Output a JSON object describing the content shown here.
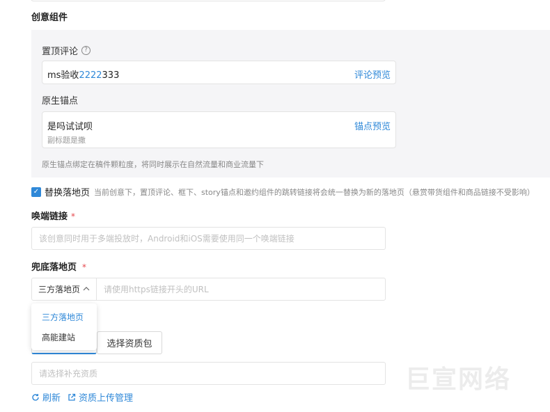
{
  "section": {
    "title": "创意组件"
  },
  "pinned_comment": {
    "label": "置顶评论",
    "help_icon": "?",
    "value_prefix": "ms验收",
    "value_highlight": "2222",
    "value_suffix": "333",
    "preview_link": "评论预览"
  },
  "native_anchor": {
    "label": "原生锚点",
    "title": "是吗试试呗",
    "subtitle": "副标题是撒",
    "preview_link": "锚点预览",
    "hint": "原生锚点绑定在稿件颗粒度，将同时展示在自然流量和商业流量下"
  },
  "replace_landing": {
    "checked": true,
    "check_mark": "✓",
    "label": "替换落地页",
    "description": "当前创意下，置顶评论、框下、story锚点和邀约组件的跳转链接将会统一替换为新的落地页（悬赏带货组件和商品链接不受影响）"
  },
  "wakeup_link": {
    "title": "唤端链接",
    "required_mark": "*",
    "placeholder": "该创意同时用于多端投放时，Android和iOS需要使用同一个唤端链接"
  },
  "fallback_landing": {
    "title": "兜底落地页",
    "required_mark": "*",
    "select_value": "三方落地页",
    "url_placeholder": "请使用https链接开头的URL",
    "options": [
      "三方落地页",
      "高能建站"
    ]
  },
  "resources": {
    "pack_button": "选择资质包",
    "placeholder": "请选择补充资质",
    "refresh": "刷新",
    "upload_manage": "资质上传管理"
  },
  "watermark": "巨宣网络",
  "colors": {
    "accent": "#2f88d8",
    "required": "#e5484d"
  }
}
